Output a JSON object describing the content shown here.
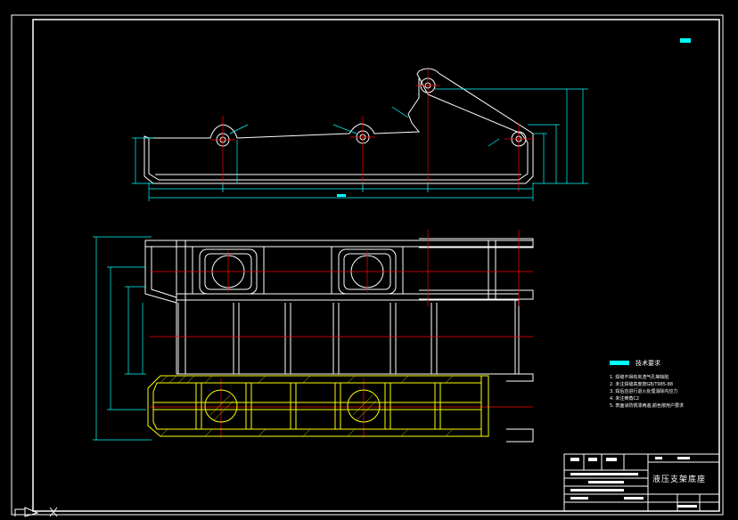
{
  "drawing": {
    "title": "液压支架底座",
    "scale_note": "▬ ▪"
  },
  "tech_requirements": {
    "title": "技术要求",
    "items": [
      "1. 焊缝不得有夹渣气孔等缺陷",
      "2. 未注焊缝高度按GB/T985-88",
      "3. 焊后应进行退火处理消除内应力",
      "4. 未注倒角C2",
      "5. 表面涂防锈漆两遍,颜色按用户要求"
    ]
  },
  "dimensions": {
    "top_total": "▬▬",
    "top_seg1": "▬",
    "top_seg2": "▬▬",
    "top_seg3": "▬",
    "plan_dim1": "▬",
    "plan_dim2": "▬",
    "plan_dim3": "▬",
    "plan_dim4": "▬"
  },
  "colors": {
    "outline": "#ffffff",
    "dimension": "#00ffff",
    "centerline": "#ff0000",
    "hatch": "#ffff00",
    "border": "#ffffff"
  }
}
